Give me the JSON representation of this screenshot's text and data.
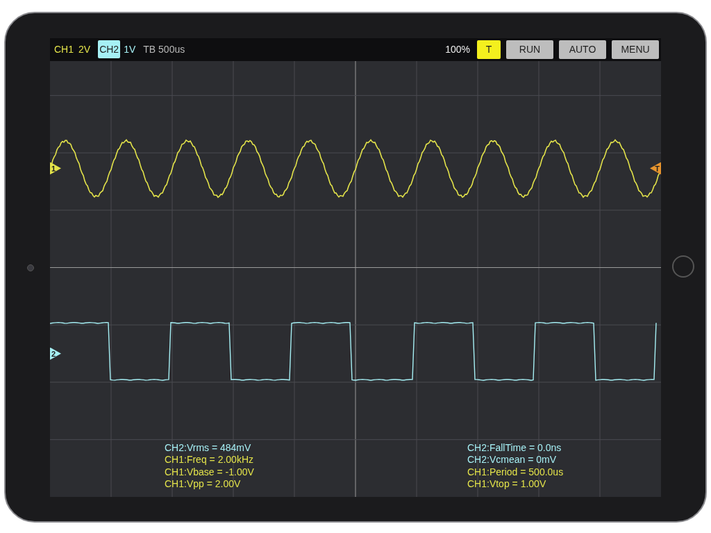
{
  "top_bar": {
    "channels": [
      {
        "label": "CH1",
        "scale": "2V",
        "color": "#e3e34a",
        "selected": false
      },
      {
        "label": "CH2",
        "scale": "1V",
        "color": "#a6f0f5",
        "selected": true
      }
    ],
    "timebase": "TB 500us",
    "zoom": "100%",
    "buttons": [
      {
        "label": "T",
        "selected": true
      },
      {
        "label": "RUN",
        "selected": false
      },
      {
        "label": "AUTO",
        "selected": false
      },
      {
        "label": "MENU",
        "selected": false
      }
    ]
  },
  "markers": [
    {
      "label": "1",
      "color": "#e3e34a",
      "kind": "channel"
    },
    {
      "label": "2",
      "color": "#a6f0f5",
      "kind": "channel"
    },
    {
      "label": "T",
      "color": "#e8952e",
      "kind": "trigger"
    }
  ],
  "measurements": [
    [
      {
        "text": "CH2:Vrms = 484mV",
        "color": "#a6f0f5"
      },
      {
        "text": "CH1:Freq = 2.00kHz",
        "color": "#e3e34a"
      },
      {
        "text": "CH1:Vbase = -1.00V",
        "color": "#e3e34a"
      },
      {
        "text": "CH1:Vpp = 2.00V",
        "color": "#e3e34a"
      }
    ],
    [
      {
        "text": "CH2:FallTime = 0.0ns",
        "color": "#a6f0f5"
      },
      {
        "text": "CH2:Vcmean = 0mV",
        "color": "#a6f0f5"
      },
      {
        "text": "CH1:Period = 500.0us",
        "color": "#e3e34a"
      },
      {
        "text": "CH1:Vtop = 1.00V",
        "color": "#e3e34a"
      }
    ]
  ]
}
